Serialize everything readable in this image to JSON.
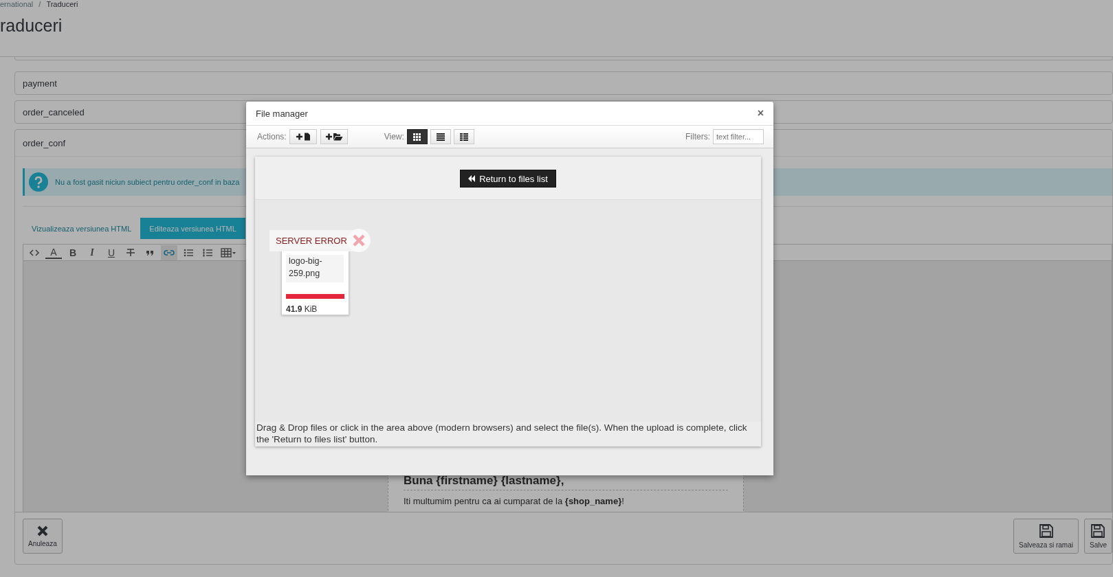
{
  "breadcrumb": {
    "items": [
      "ernational",
      "Traduceri"
    ],
    "separator": "/"
  },
  "page_title": "raduceri",
  "sections": [
    {
      "label": "payment"
    },
    {
      "label": "order_canceled"
    }
  ],
  "open_section": {
    "label": "order_conf",
    "alert": "Nu a fost gasit niciun subiect pentru order_conf in baza",
    "tabs": [
      {
        "label": "Vizualizeaza versiunea HTML",
        "selected": false
      },
      {
        "label": "Editeaza versiunea HTML",
        "selected": true
      }
    ],
    "tools": [
      {
        "kind": "code",
        "active": false
      },
      {
        "kind": "color",
        "text": "A",
        "active": false
      },
      {
        "kind": "bold",
        "text": "B",
        "active": false
      },
      {
        "kind": "italic",
        "text": "I",
        "active": false
      },
      {
        "kind": "underline",
        "text": "U",
        "active": false
      },
      {
        "kind": "strike",
        "active": false
      },
      {
        "kind": "quote",
        "active": false
      },
      {
        "kind": "link",
        "active": true
      },
      {
        "kind": "bullets",
        "active": false
      },
      {
        "kind": "numbers",
        "active": false
      },
      {
        "kind": "table",
        "active": false
      }
    ],
    "preview": {
      "greeting": "Buna {firstname} {lastname},",
      "thanks": "Iti multumim pentru ca ai cumparat de la **{shop_name}**!"
    },
    "left_buttons": [
      {
        "kind": "cancel",
        "label": "Anuleaza"
      }
    ],
    "right_buttons": [
      {
        "kind": "save",
        "label": "Salveaza si ramai"
      },
      {
        "kind": "save",
        "label": "Salve"
      }
    ]
  },
  "modal": {
    "title": "File manager",
    "close": "×",
    "actions_label": "Actions:",
    "actions": [
      {
        "kind": "new-file"
      },
      {
        "kind": "new-folder"
      }
    ],
    "view_label": "View:",
    "views": [
      {
        "kind": "grid",
        "selected": true
      },
      {
        "kind": "list",
        "selected": false
      },
      {
        "kind": "details",
        "selected": false
      }
    ],
    "filters_label": "Filters:",
    "filter_placeholder": "text filter...",
    "return_button": "Return to files list",
    "files": [
      {
        "name": "logo-big-259.png",
        "size": "**41.9** KiB",
        "error": "SERVER ERROR",
        "level": 1
      }
    ],
    "help_text": "Drag & Drop files or click in the area above (modern browsers) and select the file(s). When the upload is complete, click the 'Return to files list' button."
  }
}
